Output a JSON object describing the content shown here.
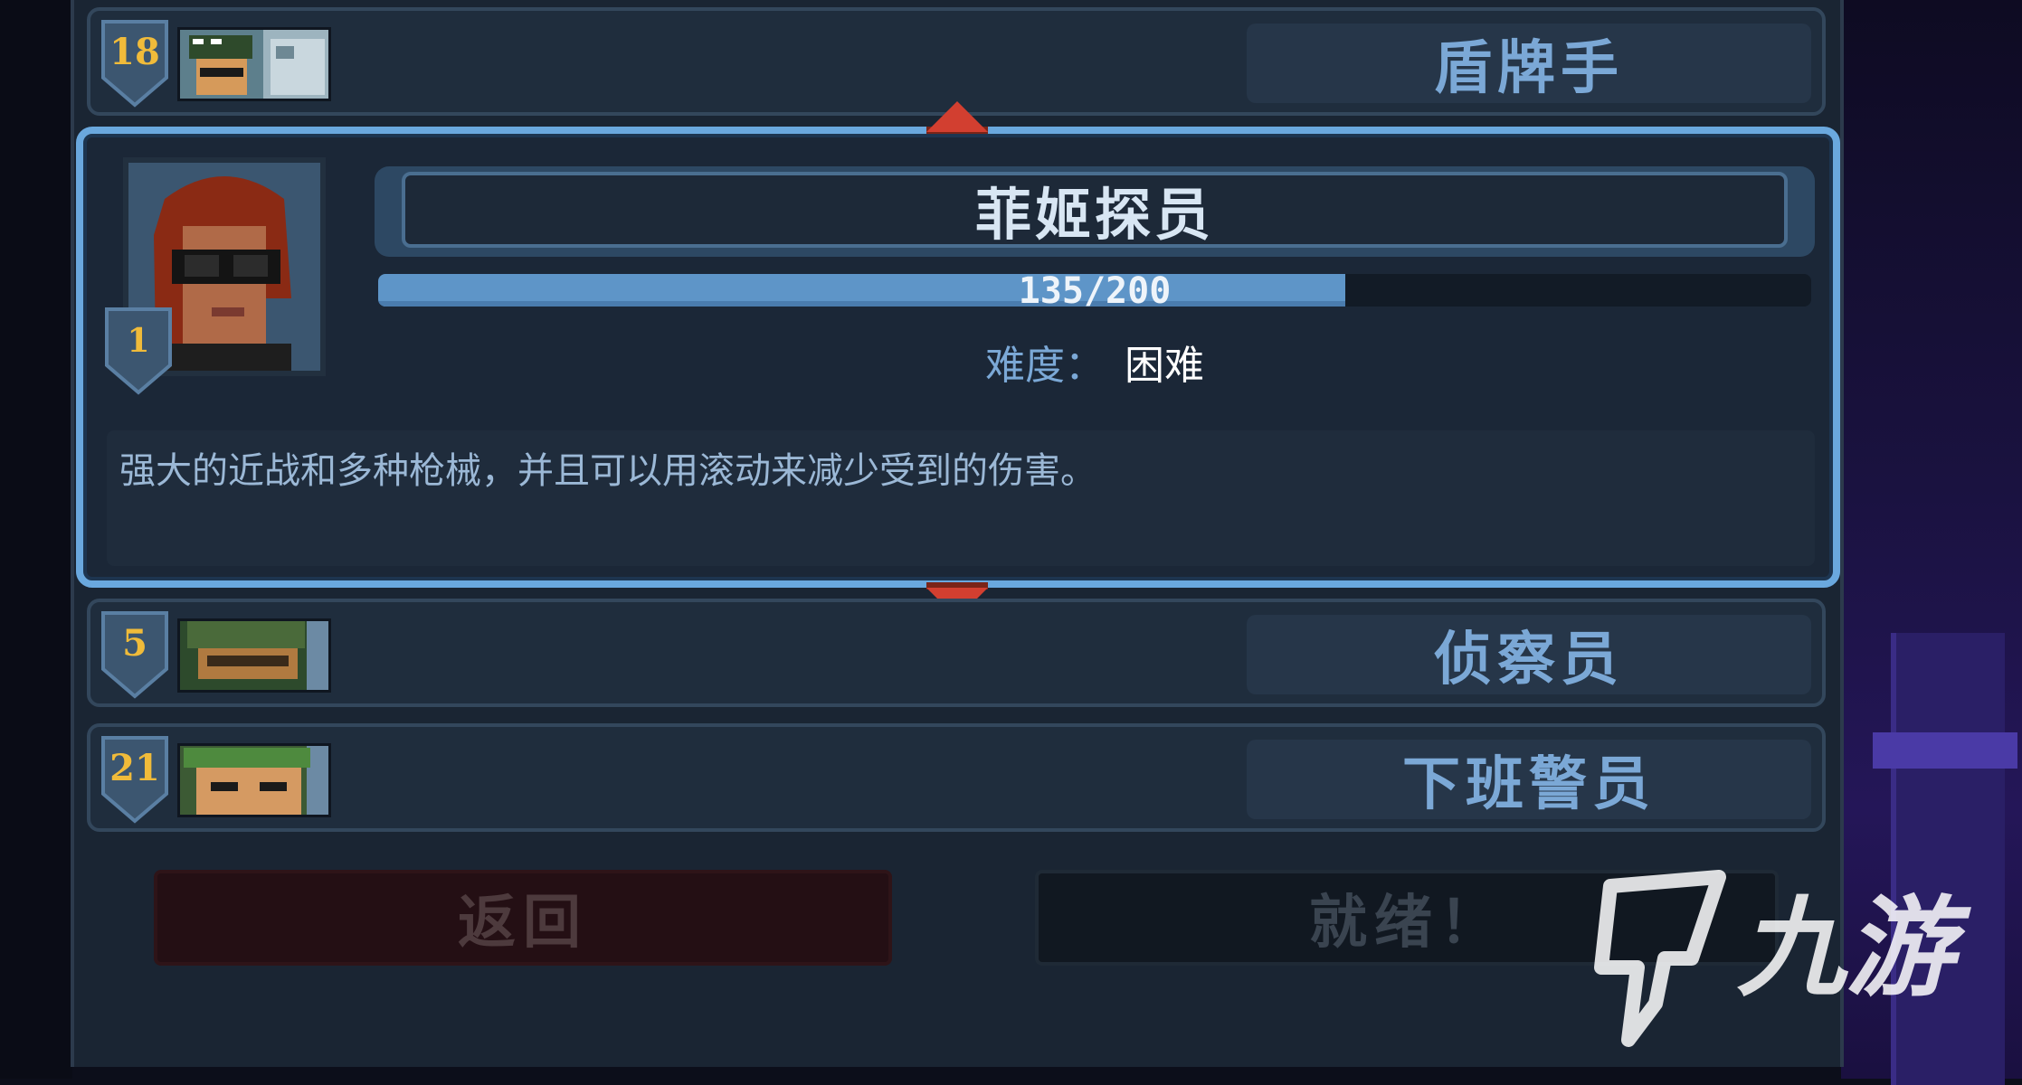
{
  "roster": {
    "top": {
      "level": "18",
      "name": "盾牌手"
    },
    "selected": {
      "level": "1",
      "name": "菲姬探员",
      "xp_text": "135/200",
      "xp_fraction": 0.675,
      "difficulty_label": "难度：",
      "difficulty_value": "困难",
      "description": "强大的近战和多种枪械，并且可以用滚动来减少受到的伤害。"
    },
    "mid": {
      "level": "5",
      "name": "侦察员"
    },
    "bottom": {
      "level": "21",
      "name": "下班警员"
    }
  },
  "buttons": {
    "back": "返回",
    "ready": "就绪！"
  },
  "watermark": {
    "text": "九游"
  },
  "colors": {
    "accent_blue": "#6aa8de",
    "level_gold": "#f0bb3a",
    "arrow_red": "#d23f30"
  }
}
